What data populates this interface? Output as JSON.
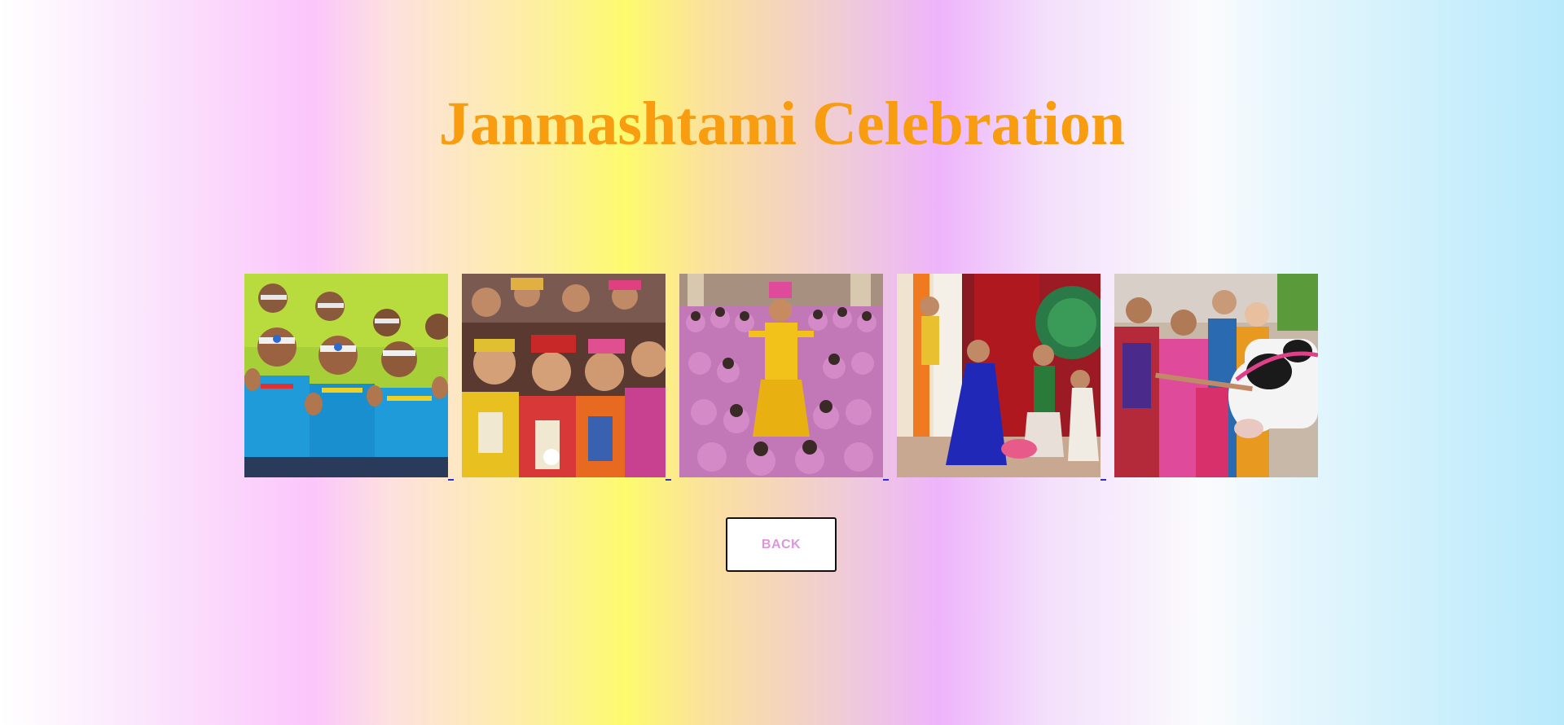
{
  "page": {
    "title": "Janmashtami Celebration"
  },
  "gallery": {
    "photos": [
      {
        "icon": "children-waving-photo"
      },
      {
        "icon": "children-in-costumes-photo"
      },
      {
        "icon": "krishna-dancer-with-students-photo"
      },
      {
        "icon": "stage-performance-photo"
      },
      {
        "icon": "girls-with-cow-statue-photo"
      }
    ]
  },
  "actions": {
    "back_label": "BACK"
  },
  "colors": {
    "title": "#f89c10",
    "back_text": "#dc96dc",
    "link_underline": "#2a30d8"
  }
}
